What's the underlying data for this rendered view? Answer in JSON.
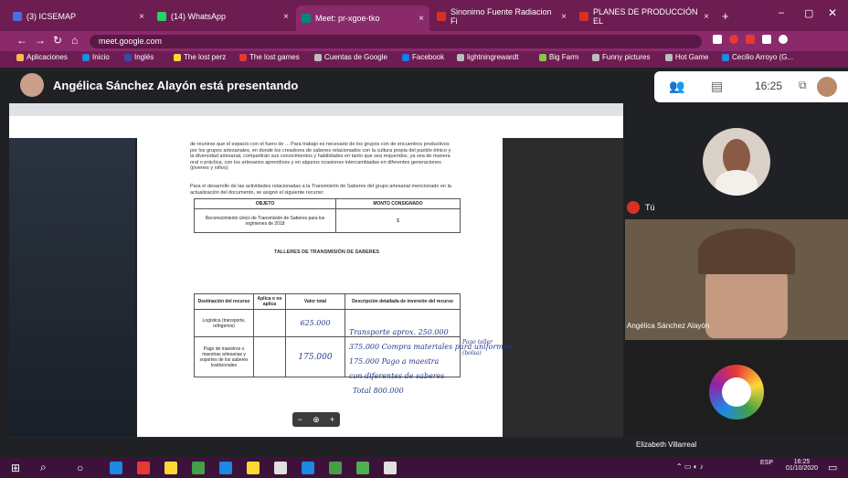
{
  "browser": {
    "tabs": [
      {
        "label": "(3) ICSEMAP",
        "color": "#4a6ee0"
      },
      {
        "label": "(14) WhatsApp",
        "color": "#25d366"
      },
      {
        "label": "Meet: pr-xgoe-tko",
        "color": "#00897b",
        "active": true
      },
      {
        "label": "Sinonimo Fuente Radiacion Fi",
        "color": "#d93025"
      },
      {
        "label": "PLANES DE PRODUCCIÓN EL",
        "color": "#d93025"
      }
    ],
    "url": "meet.google.com",
    "bookmarks": [
      {
        "label": "Aplicaciones",
        "color": "#ffb74d"
      },
      {
        "label": "Inicio",
        "color": "#1e88e5"
      },
      {
        "label": "Inglés",
        "color": "#3949ab"
      },
      {
        "label": "The lost perz",
        "color": "#fdd835"
      },
      {
        "label": "The lost games",
        "color": "#e53935"
      },
      {
        "label": "Cuentas de Google",
        "color": "#bdbdbd"
      },
      {
        "label": "Facebook",
        "color": "#1877f2"
      },
      {
        "label": "lightningrewardt",
        "color": "#bdbdbd"
      },
      {
        "label": "Big Farm",
        "color": "#8bc34a"
      },
      {
        "label": "Funny pictures",
        "color": "#bdbdbd"
      },
      {
        "label": "Hot Game",
        "color": "#bdbdbd"
      },
      {
        "label": "Cecilio Arroyo (G...",
        "color": "#1e88e5"
      }
    ]
  },
  "meet": {
    "presenter_text": "Angélica Sánchez Alayón está presentando",
    "time": "16:25",
    "self_label": "Tú",
    "participant_cam": "Angélica Sánchez Alayón",
    "participant_bottom": "Elizabeth Villarreal"
  },
  "document": {
    "para1": "de reunirse que el espacio con el fuero de ... Para trabajo es necesario de los grupos con de encuentros productivos por los grupos artesanales, en donde los creadores de saberes relacionados con la cultura propia del pueblo étnico y la diversidad artesanal, compartirán sus conocimientos y habilidades en tanto que sea requeridos, ya sea de manera oral o práctica, con los artesanos aprendices y en algunos ocasiones intercambiadas en diferentes generaciones (jóvenes y niños)",
    "para2": "Para el desarrollo de las actividades relacionadas a la Transmisión de Saberes del grupo artesanal mencionado en la actualización del documento, se asignó el siguiente recurso:",
    "table1": {
      "headers": [
        "OBJETO",
        "MONTO CONSIGNADO"
      ],
      "row": [
        "Reconocimiento único de Transmisión de Saberes para los regímenes de 2018",
        "$"
      ]
    },
    "section_title": "TALLERES DE TRANSMISIÓN DE SABERES",
    "table2": {
      "headers": [
        "Destinación del recurso",
        "Aplica o no aplica",
        "Valor total",
        "Descripción detallada de inversión del recurso"
      ],
      "rows": [
        [
          "Logística (transporte, refrigerios)",
          "",
          "625.000",
          ""
        ],
        [
          "Pago de maestros o maestras artesanas y soportes de los saberes tradicionales",
          "",
          "175.000",
          ""
        ]
      ]
    },
    "handwriting": [
      "Transporte aprox. 250.000",
      "375.000 Compra materiales para uniformes",
      "175.000 Pago a maestra",
      "con diferentes de saberes",
      "Total 800.000",
      "Pago taller",
      "(bolsa)"
    ],
    "zoom": [
      "−",
      "⊕",
      "+"
    ]
  },
  "taskbar": {
    "search_placeholder": "Escribe aquí para buscar",
    "clock_time": "16:25",
    "clock_date": "01/10/2020",
    "lang": "ESP"
  }
}
